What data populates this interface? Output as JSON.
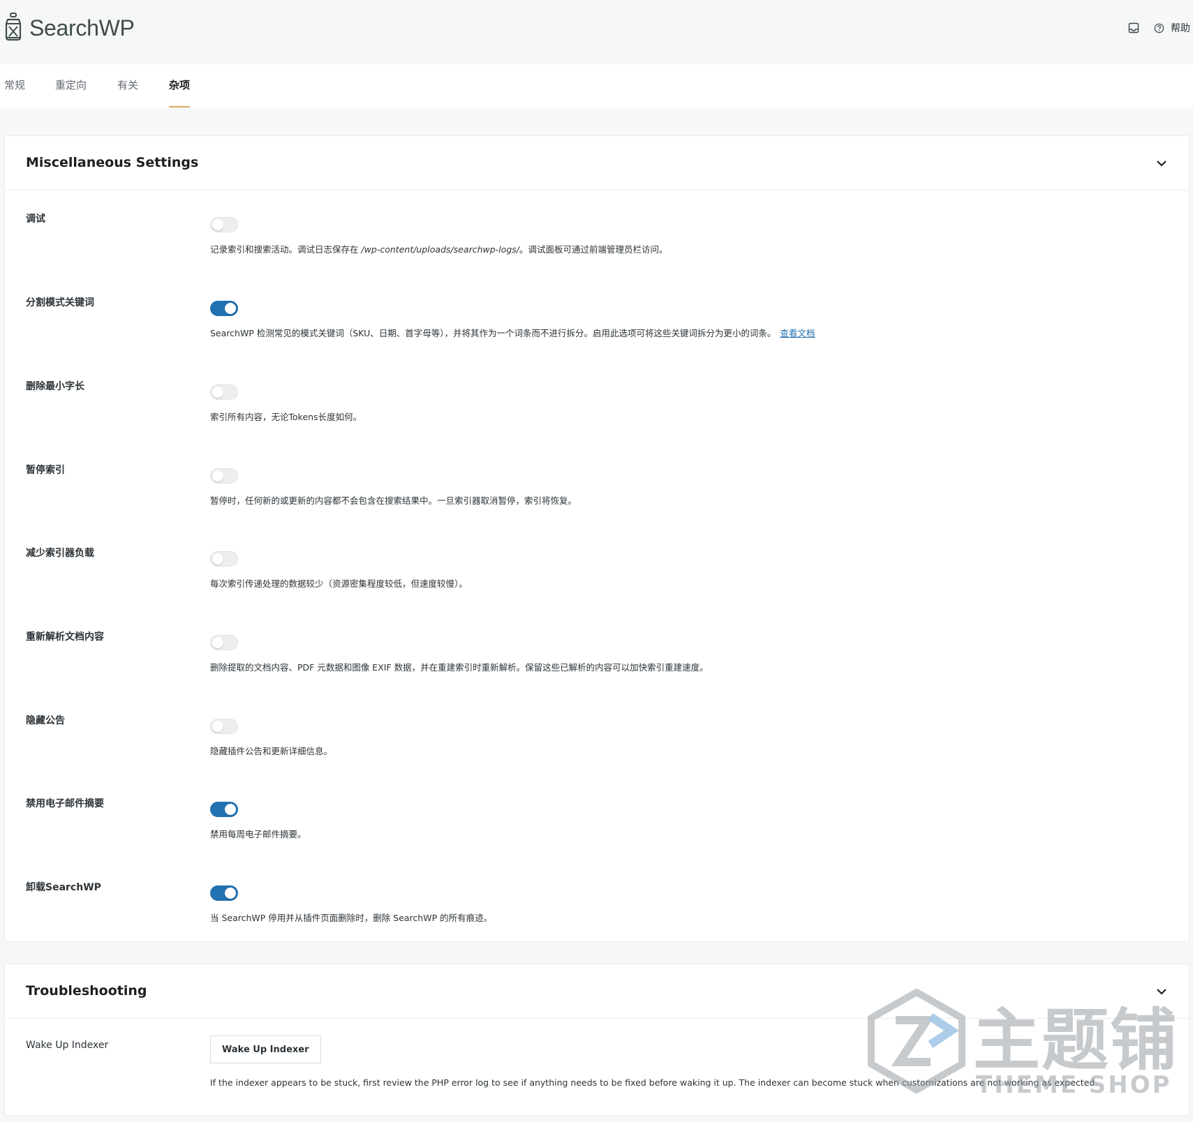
{
  "header": {
    "app_name": "SearchWP",
    "help_label": "帮助",
    "icons": [
      "searchwp-lantern-logo",
      "inbox-icon",
      "help-circle-icon"
    ]
  },
  "tabs": [
    {
      "label": "常规",
      "active": false
    },
    {
      "label": "重定向",
      "active": false
    },
    {
      "label": "有关",
      "active": false
    },
    {
      "label": "杂项",
      "active": true
    }
  ],
  "misc": {
    "title": "Miscellaneous Settings",
    "items": [
      {
        "label": "调试",
        "enabled": false,
        "desc_pre": "记录索引和搜索活动。调试日志保存在 ",
        "desc_path": "/wp-content/uploads/searchwp-logs/",
        "desc_post": "。调试面板可通过前端管理员栏访问。"
      },
      {
        "label": "分割模式关键词",
        "enabled": true,
        "desc": "SearchWP 检测常见的模式关键词（SKU、日期、首字母等），并将其作为一个词条而不进行拆分。启用此选项可将这些关键词拆分为更小的词条。",
        "link": "查看文档"
      },
      {
        "label": "删除最小字长",
        "enabled": false,
        "desc": "索引所有内容，无论Tokens长度如何。"
      },
      {
        "label": "暂停索引",
        "enabled": false,
        "desc": "暂停时，任何新的或更新的内容都不会包含在搜索结果中。一旦索引器取消暂停，索引将恢复。"
      },
      {
        "label": "减少索引器负载",
        "enabled": false,
        "desc": "每次索引传递处理的数据较少（资源密集程度较低，但速度较慢）。"
      },
      {
        "label": "重新解析文档内容",
        "enabled": false,
        "desc": "删除提取的文档内容、PDF 元数据和图像 EXIF 数据，并在重建索引时重新解析。保留这些已解析的内容可以加快索引重建速度。"
      },
      {
        "label": "隐藏公告",
        "enabled": false,
        "desc": "隐藏插件公告和更新详细信息。"
      },
      {
        "label": "禁用电子邮件摘要",
        "enabled": true,
        "desc": "禁用每周电子邮件摘要。"
      },
      {
        "label": "卸载SearchWP",
        "enabled": true,
        "desc": "当 SearchWP 停用并从插件页面删除时，删除 SearchWP 的所有痕迹。"
      }
    ]
  },
  "troubleshooting": {
    "title": "Troubleshooting",
    "row_label": "Wake Up Indexer",
    "button_label": "Wake Up Indexer",
    "desc": "If the indexer appears to be stuck, first review the PHP error log to see if anything needs to be fixed before waking it up. The indexer can become stuck when customizations are not working as expected."
  },
  "watermark": {
    "cn": "主题铺",
    "en": "THEME SHOP"
  },
  "colors": {
    "accent": "#2271b1",
    "tab_underline": "#d9a85c",
    "brand_text": "#3f4d48"
  }
}
